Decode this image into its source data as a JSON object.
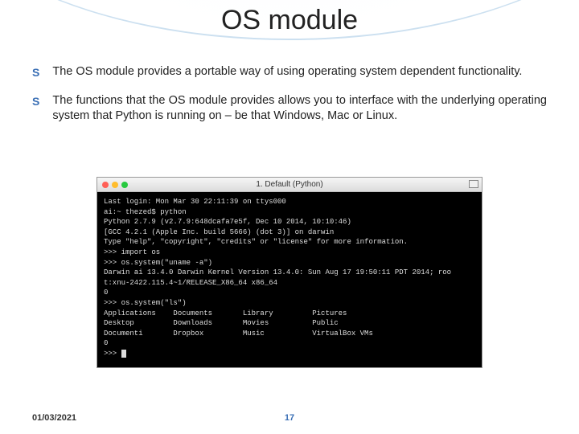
{
  "title": "OS module",
  "bullets": [
    "The OS module provides a portable way of using operating system dependent functionality.",
    "The functions that the OS module provides allows you to interface with the underlying operating system that Python is running on – be that Windows, Mac or Linux."
  ],
  "terminal": {
    "window_title": "1. Default (Python)",
    "lines": [
      "Last login: Mon Mar 30 22:11:39 on ttys000",
      "ai:~ thezed$ python",
      "Python 2.7.9 (v2.7.9:648dcafa7e5f, Dec 10 2014, 10:10:46)",
      "[GCC 4.2.1 (Apple Inc. build 5666) (dot 3)] on darwin",
      "Type \"help\", \"copyright\", \"credits\" or \"license\" for more information.",
      ">>> import os",
      ">>> os.system(\"uname -a\")",
      "Darwin ai 13.4.0 Darwin Kernel Version 13.4.0: Sun Aug 17 19:50:11 PDT 2014; roo",
      "t:xnu-2422.115.4~1/RELEASE_X86_64 x86_64",
      "0",
      ">>> os.system(\"ls\")",
      "Applications    Documents       Library         Pictures",
      "Desktop         Downloads       Movies          Public",
      "Documenti       Dropbox         Music           VirtualBox VMs",
      "0",
      ">>> "
    ]
  },
  "footer": {
    "date": "01/03/2021",
    "page": "17"
  }
}
